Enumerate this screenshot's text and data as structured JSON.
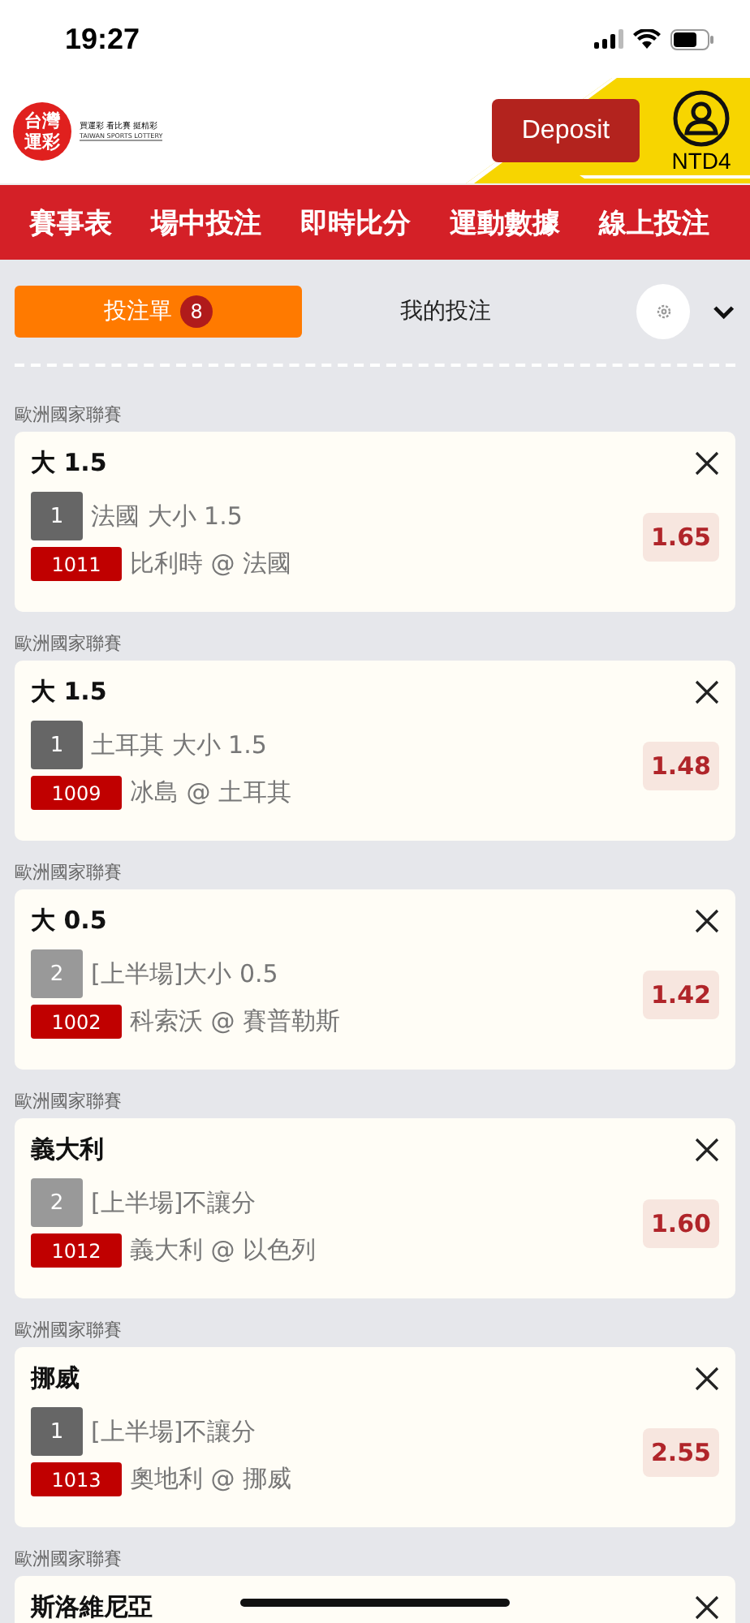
{
  "status_bar": {
    "time": "19:27"
  },
  "header": {
    "logo": "台灣運彩",
    "slogan": "買運彩 看比賽 挺精彩",
    "logo_subtitle": "TAIWAN SPORTS LOTTERY",
    "deposit_button": "Deposit",
    "account": "NTD4"
  },
  "nav": [
    {
      "label": "賽事表"
    },
    {
      "label": "場中投注"
    },
    {
      "label": "即時比分"
    },
    {
      "label": "運動數據"
    },
    {
      "label": "線上投注"
    }
  ],
  "tabs": [
    {
      "label": "投注單",
      "badge": "8",
      "selected": true
    },
    {
      "label": "我的投注",
      "selected": false
    }
  ],
  "bets": [
    {
      "league": "歐洲國家聯賽",
      "title": "大 1.5",
      "number": "1",
      "color": "#666666",
      "market": "法國 大小 1.5",
      "code": "1011",
      "match": "比利時 @ 法國",
      "odds": "1.65"
    },
    {
      "league": "歐洲國家聯賽",
      "title": "大 1.5",
      "number": "1",
      "color": "#666666",
      "market": "土耳其 大小 1.5",
      "code": "1009",
      "match": "冰島 @ 土耳其",
      "odds": "1.48"
    },
    {
      "league": "歐洲國家聯賽",
      "title": "大 0.5",
      "number": "2",
      "color": "#999999",
      "market": "[上半場]大小 0.5",
      "code": "1002",
      "match": "科索沃 @ 賽普勒斯",
      "odds": "1.42"
    },
    {
      "league": "歐洲國家聯賽",
      "title": "義大利",
      "number": "2",
      "color": "#999999",
      "market": "[上半場]不讓分",
      "code": "1012",
      "match": "義大利 @ 以色列",
      "odds": "1.60"
    },
    {
      "league": "歐洲國家聯賽",
      "title": "挪威",
      "number": "1",
      "color": "#666666",
      "market": "[上半場]不讓分",
      "code": "1013",
      "match": "奧地利 @ 挪威",
      "odds": "2.55"
    },
    {
      "league": "歐洲國家聯賽",
      "title": "斯洛維尼亞"
    }
  ]
}
